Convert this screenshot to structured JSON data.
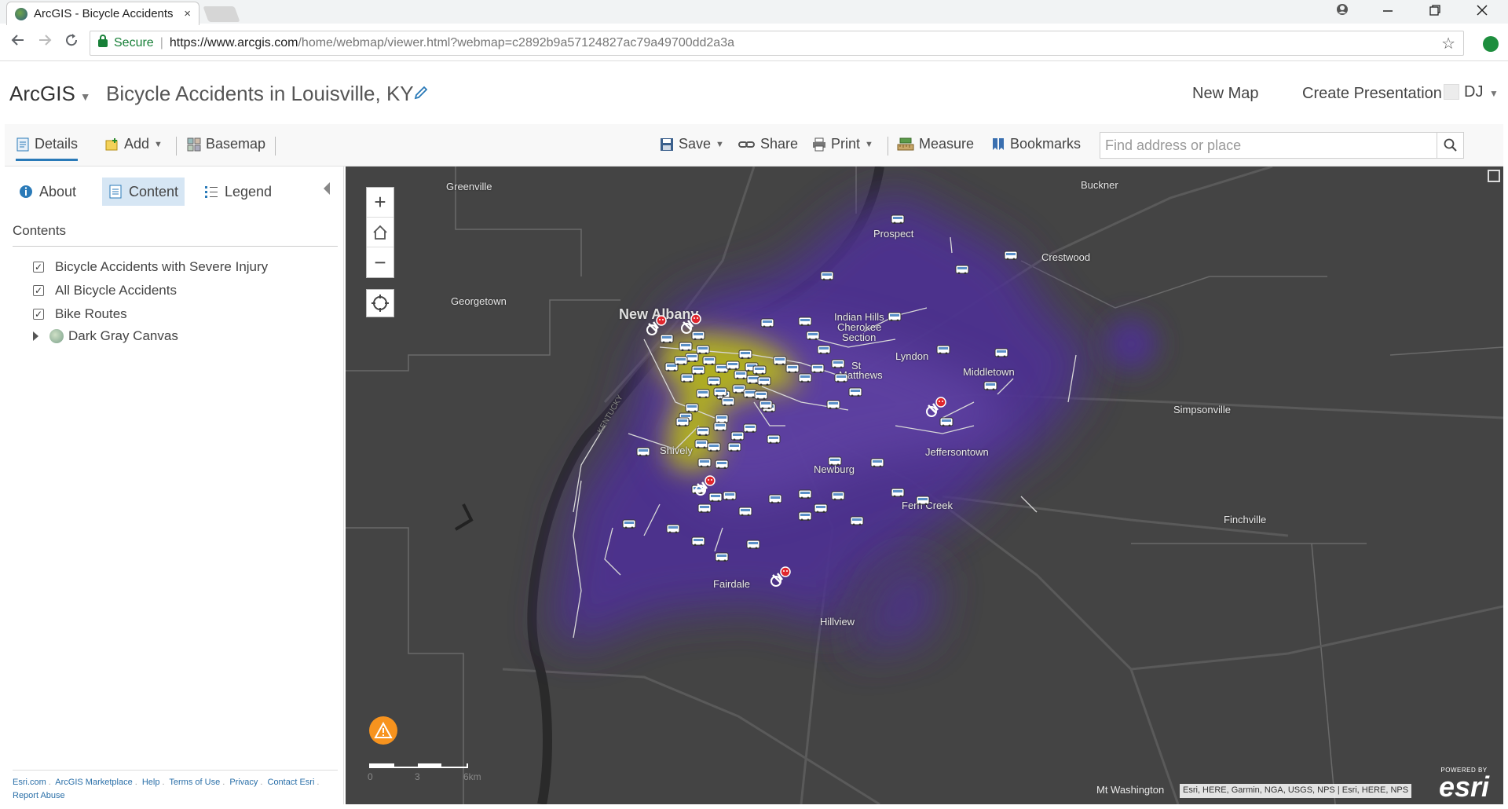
{
  "browser": {
    "tab_title": "ArcGIS - Bicycle Accidents",
    "tab_close": "×",
    "secure_label": "Secure",
    "url_host": "https://www.arcgis.com",
    "url_path": "/home/webmap/viewer.html?webmap=c2892b9a57124827ac79a49700dd2a3a"
  },
  "app": {
    "brand": "ArcGIS",
    "map_title": "Bicycle Accidents in Louisville, KY",
    "new_map": "New Map",
    "create_presentation": "Create Presentation",
    "user_initials": "DJ"
  },
  "toolbar": {
    "details": "Details",
    "add": "Add",
    "basemap": "Basemap",
    "save": "Save",
    "share": "Share",
    "print": "Print",
    "measure": "Measure",
    "bookmarks": "Bookmarks",
    "search_placeholder": "Find address or place"
  },
  "panel": {
    "tabs": {
      "about": "About",
      "content": "Content",
      "legend": "Legend"
    },
    "contents_heading": "Contents",
    "layers": [
      {
        "label": "Bicycle Accidents with Severe Injury",
        "checked": true
      },
      {
        "label": "All Bicycle Accidents",
        "checked": true
      },
      {
        "label": "Bike Routes",
        "checked": true
      },
      {
        "label": "Dark Gray Canvas",
        "checked": null
      }
    ],
    "footer_links": [
      "Esri.com",
      "ArcGIS Marketplace",
      "Help",
      "Terms of Use",
      "Privacy",
      "Contact Esri",
      "Report Abuse"
    ]
  },
  "map": {
    "places": {
      "greenville": "Greenville",
      "buckner": "Buckner",
      "prospect": "Prospect",
      "crestwood": "Crestwood",
      "georgetown": "Georgetown",
      "new_albany": "New Albany",
      "indian_hills_1": "Indian Hills",
      "indian_hills_2": "Cherokee",
      "indian_hills_3": "Section",
      "lyndon": "Lyndon",
      "middletown": "Middletown",
      "st_matthews_1": "St",
      "st_matthews_2": "Matthews",
      "simpsonville": "Simpsonville",
      "jeffersontown": "Jeffersontown",
      "shively": "Shively",
      "newburg": "Newburg",
      "fern_creek": "Fern Creek",
      "finchville": "Finchville",
      "fairdale": "Fairdale",
      "hillview": "Hillview",
      "mt_washington": "Mt Washington",
      "kentucky": "KENTUCKY"
    },
    "zoom_in": "+",
    "zoom_out": "−",
    "scale_labels": {
      "zero": "0",
      "mid": "3",
      "end": "6km"
    },
    "attribution": "Esri, HERE, Garmin, NGA, USGS, NPS | Esri, HERE, NPS",
    "powered_by": "POWERED BY",
    "esri": "esri"
  },
  "colors": {
    "map_bg": "#444444",
    "heat_purple": "#5b3a9e",
    "heat_yellow": "#b6b41a",
    "accent": "#2a7ab8",
    "severe_marker": "#e0262e",
    "warning": "#f7931e"
  },
  "icons": {
    "accident_marker": "car-icon",
    "severe_marker": "cyclist-skull-icon"
  }
}
